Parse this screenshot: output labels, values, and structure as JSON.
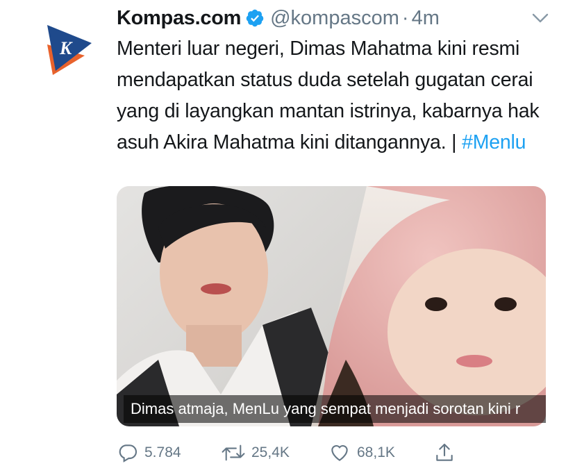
{
  "tweet": {
    "author_name": "Kompas.com",
    "handle": "@kompascom",
    "separator": "·",
    "time": "4m",
    "text": "Menteri luar negeri, Dimas Mahatma kini resmi mendapatkan status duda setelah gugatan cerai yang di layangkan mantan istrinya, kabarnya hak asuh Akira Mahatma kini ditangannya. | ",
    "hashtag": "#Menlu",
    "media_caption": "Dimas atmaja, MenLu yang sempat menjadi sorotan kini r",
    "avatar_letter": "K"
  },
  "actions": {
    "replies": "5.784",
    "retweets": "25,4K",
    "likes": "68,1K"
  },
  "colors": {
    "link": "#1da1f2",
    "secondary_text": "#657786",
    "verified": "#1da1f2",
    "brand_orange": "#e8622c",
    "brand_blue": "#1f4a8c"
  },
  "icons": [
    "verified-icon",
    "chevron-down-icon",
    "reply-icon",
    "retweet-icon",
    "like-icon",
    "share-icon"
  ]
}
